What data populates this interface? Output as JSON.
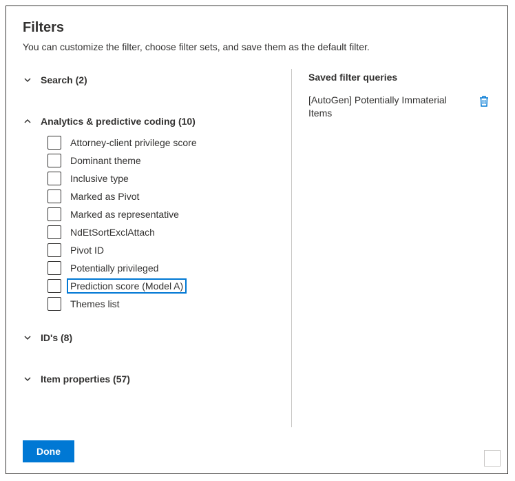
{
  "title": "Filters",
  "subtitle": "You can customize the filter, choose filter sets, and save them as the default filter.",
  "sections": {
    "search": {
      "label": "Search (2)",
      "expanded": false
    },
    "analytics": {
      "label": "Analytics & predictive coding (10)",
      "expanded": true,
      "options": [
        {
          "label": "Attorney-client privilege score",
          "focused": false
        },
        {
          "label": "Dominant theme",
          "focused": false
        },
        {
          "label": "Inclusive type",
          "focused": false
        },
        {
          "label": "Marked as Pivot",
          "focused": false
        },
        {
          "label": "Marked as representative",
          "focused": false
        },
        {
          "label": "NdEtSortExclAttach",
          "focused": false
        },
        {
          "label": "Pivot ID",
          "focused": false
        },
        {
          "label": "Potentially privileged",
          "focused": false
        },
        {
          "label": "Prediction score (Model A)",
          "focused": true
        },
        {
          "label": "Themes list",
          "focused": false
        }
      ]
    },
    "ids": {
      "label": "ID's (8)",
      "expanded": false
    },
    "itemprops": {
      "label": "Item properties (57)",
      "expanded": false
    }
  },
  "saved": {
    "title": "Saved filter queries",
    "items": [
      {
        "name": "[AutoGen] Potentially Immaterial Items"
      }
    ]
  },
  "footer": {
    "done": "Done"
  }
}
